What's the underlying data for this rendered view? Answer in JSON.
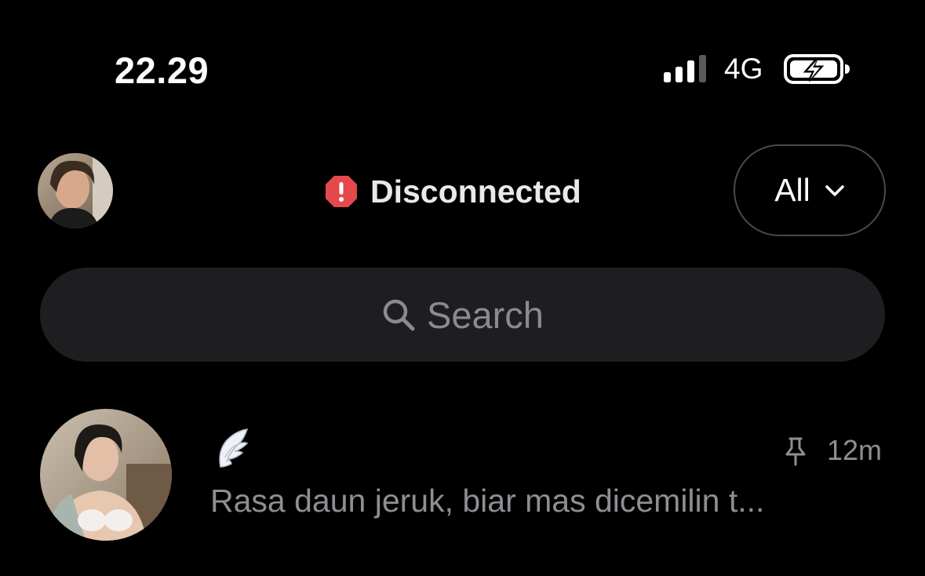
{
  "status_bar": {
    "time": "22.29",
    "network": "4G",
    "signal_icon": "cellular-signal-icon",
    "battery_icon": "battery-charging-icon"
  },
  "header": {
    "status_label": "Disconnected",
    "status_icon": "alert-octagon-icon",
    "status_color": "#e5484d",
    "filter_label": "All",
    "filter_icon": "chevron-down-icon"
  },
  "search": {
    "placeholder": "Search",
    "icon": "search-icon"
  },
  "conversations": [
    {
      "name_icon": "angel-wing-emoji",
      "pinned": true,
      "time": "12m",
      "preview": "Rasa daun jeruk, biar mas dicemilin t..."
    }
  ],
  "colors": {
    "background": "#000000",
    "search_bg": "#1e1e21",
    "muted_text": "#8e8e93"
  }
}
